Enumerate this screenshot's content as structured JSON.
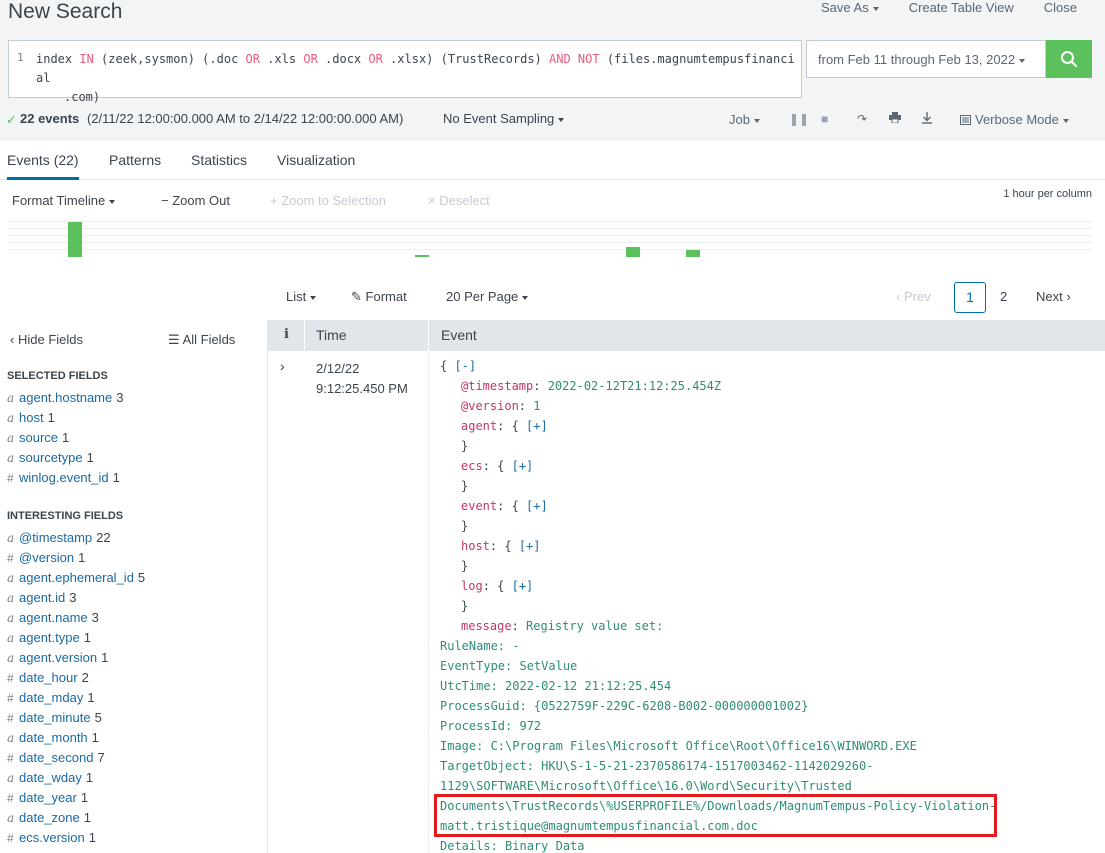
{
  "header": {
    "title": "New Search",
    "save_as": "Save As",
    "create_table_view": "Create Table View",
    "close": "Close"
  },
  "search": {
    "line_number": "1",
    "query_parts": [
      "index ",
      "IN",
      " (zeek,sysmon) (.doc ",
      "OR",
      " .xls ",
      "OR",
      " .docx ",
      "OR",
      " .xlsx) (TrustRecords) ",
      "AND",
      " ",
      "NOT",
      " (files.magnumtempusfinancial"
    ],
    "query_line2": ".com)",
    "time_range": "from Feb 11 through Feb 13, 2022"
  },
  "status": {
    "check": "✓",
    "event_count": "22 events",
    "event_range": "(2/11/22 12:00:00.000 AM to 2/14/22 12:00:00.000 AM)",
    "sampling": "No Event Sampling",
    "job": "Job",
    "mode": "Verbose Mode"
  },
  "tabs": {
    "events": "Events (22)",
    "patterns": "Patterns",
    "statistics": "Statistics",
    "visualization": "Visualization"
  },
  "timeline": {
    "format": "Format Timeline",
    "zoom_out": "Zoom Out",
    "zoom_selection": "Zoom to Selection",
    "deselect": "Deselect",
    "per_column": "1 hour per column"
  },
  "results_bar": {
    "list": "List",
    "format": "Format",
    "per_page": "20 Per Page",
    "prev": "Prev",
    "page1": "1",
    "page2": "2",
    "next": "Next"
  },
  "sidebar": {
    "hide_fields": "Hide Fields",
    "all_fields": "All Fields",
    "selected_heading": "SELECTED FIELDS",
    "interesting_heading": "INTERESTING FIELDS",
    "selected_fields": [
      {
        "type": "a",
        "name": "agent.hostname",
        "count": "3"
      },
      {
        "type": "a",
        "name": "host",
        "count": "1"
      },
      {
        "type": "a",
        "name": "source",
        "count": "1"
      },
      {
        "type": "a",
        "name": "sourcetype",
        "count": "1"
      },
      {
        "type": "#",
        "name": "winlog.event_id",
        "count": "1"
      }
    ],
    "interesting_fields": [
      {
        "type": "a",
        "name": "@timestamp",
        "count": "22"
      },
      {
        "type": "#",
        "name": "@version",
        "count": "1"
      },
      {
        "type": "a",
        "name": "agent.ephemeral_id",
        "count": "5"
      },
      {
        "type": "a",
        "name": "agent.id",
        "count": "3"
      },
      {
        "type": "a",
        "name": "agent.name",
        "count": "3"
      },
      {
        "type": "a",
        "name": "agent.type",
        "count": "1"
      },
      {
        "type": "a",
        "name": "agent.version",
        "count": "1"
      },
      {
        "type": "#",
        "name": "date_hour",
        "count": "2"
      },
      {
        "type": "#",
        "name": "date_mday",
        "count": "1"
      },
      {
        "type": "#",
        "name": "date_minute",
        "count": "5"
      },
      {
        "type": "a",
        "name": "date_month",
        "count": "1"
      },
      {
        "type": "#",
        "name": "date_second",
        "count": "7"
      },
      {
        "type": "a",
        "name": "date_wday",
        "count": "1"
      },
      {
        "type": "#",
        "name": "date_year",
        "count": "1"
      },
      {
        "type": "a",
        "name": "date_zone",
        "count": "1"
      },
      {
        "type": "#",
        "name": "ecs.version",
        "count": "1"
      }
    ]
  },
  "table": {
    "col_info": "i",
    "col_time": "Time",
    "col_event": "Event",
    "row_date": "2/12/22",
    "row_time": "9:12:25.450 PM",
    "event_lines": [
      {
        "ind": 0,
        "parts": [
          [
            "b",
            "{ "
          ],
          [
            "lnk",
            "[-]"
          ]
        ]
      },
      {
        "ind": 1,
        "parts": [
          [
            "k",
            "@timestamp"
          ],
          [
            "b",
            ": "
          ],
          [
            "v",
            "2022-02-12T21:12:25.454Z"
          ]
        ]
      },
      {
        "ind": 1,
        "parts": [
          [
            "k",
            "@version"
          ],
          [
            "b",
            ": "
          ],
          [
            "v",
            "1"
          ]
        ]
      },
      {
        "ind": 1,
        "parts": [
          [
            "k",
            "agent"
          ],
          [
            "b",
            ": { "
          ],
          [
            "lnk",
            "[+]"
          ]
        ]
      },
      {
        "ind": 1,
        "parts": [
          [
            "b",
            "}"
          ]
        ]
      },
      {
        "ind": 1,
        "parts": [
          [
            "k",
            "ecs"
          ],
          [
            "b",
            ": { "
          ],
          [
            "lnk",
            "[+]"
          ]
        ]
      },
      {
        "ind": 1,
        "parts": [
          [
            "b",
            "}"
          ]
        ]
      },
      {
        "ind": 1,
        "parts": [
          [
            "k",
            "event"
          ],
          [
            "b",
            ": { "
          ],
          [
            "lnk",
            "[+]"
          ]
        ]
      },
      {
        "ind": 1,
        "parts": [
          [
            "b",
            "}"
          ]
        ]
      },
      {
        "ind": 1,
        "parts": [
          [
            "k",
            "host"
          ],
          [
            "b",
            ": { "
          ],
          [
            "lnk",
            "[+]"
          ]
        ]
      },
      {
        "ind": 1,
        "parts": [
          [
            "b",
            "}"
          ]
        ]
      },
      {
        "ind": 1,
        "parts": [
          [
            "k",
            "log"
          ],
          [
            "b",
            ": { "
          ],
          [
            "lnk",
            "[+]"
          ]
        ]
      },
      {
        "ind": 1,
        "parts": [
          [
            "b",
            "}"
          ]
        ]
      },
      {
        "ind": 1,
        "parts": [
          [
            "k",
            "message"
          ],
          [
            "b",
            ": "
          ],
          [
            "v",
            "Registry value set:"
          ]
        ]
      },
      {
        "ind": 0,
        "parts": [
          [
            "v",
            "RuleName: -"
          ]
        ]
      },
      {
        "ind": 0,
        "parts": [
          [
            "v",
            "EventType: SetValue"
          ]
        ]
      },
      {
        "ind": 0,
        "parts": [
          [
            "v",
            "UtcTime: 2022-02-12 21:12:25.454"
          ]
        ]
      },
      {
        "ind": 0,
        "parts": [
          [
            "v",
            "ProcessGuid: {0522759F-229C-6208-B002-000000001002}"
          ]
        ]
      },
      {
        "ind": 0,
        "parts": [
          [
            "v",
            "ProcessId: 972"
          ]
        ]
      },
      {
        "ind": 0,
        "parts": [
          [
            "v",
            "Image: C:\\Program Files\\Microsoft Office\\Root\\Office16\\WINWORD.EXE"
          ]
        ]
      },
      {
        "ind": 0,
        "parts": [
          [
            "v",
            "TargetObject: HKU\\S-1-5-21-2370586174-1517003462-1142029260-"
          ]
        ]
      },
      {
        "ind": 0,
        "parts": [
          [
            "v",
            "1129\\SOFTWARE\\Microsoft\\Office\\16.0\\Word\\Security\\Trusted"
          ]
        ]
      },
      {
        "ind": 0,
        "parts": [
          [
            "v",
            "Documents\\TrustRecords\\%USERPROFILE%/Downloads/MagnumTempus-Policy-Violation-"
          ]
        ]
      },
      {
        "ind": 0,
        "parts": [
          [
            "v",
            "matt.tristique@magnumtempusfinancial.com.doc"
          ]
        ]
      },
      {
        "ind": 0,
        "parts": [
          [
            "v",
            "Details: Binary Data"
          ]
        ]
      }
    ]
  },
  "colors": {
    "accent_green": "#5cc05c",
    "link_blue": "#1a6aa3",
    "key_pink": "#c4356a",
    "value_teal": "#2c8e77",
    "highlight_red": "#e21a1a"
  },
  "icons": [
    "search-icon",
    "pause-icon",
    "stop-icon",
    "share-icon",
    "print-icon",
    "download-icon",
    "mode-icon",
    "chevron-left-icon",
    "chevron-right-icon",
    "list-icon",
    "pencil-icon"
  ]
}
